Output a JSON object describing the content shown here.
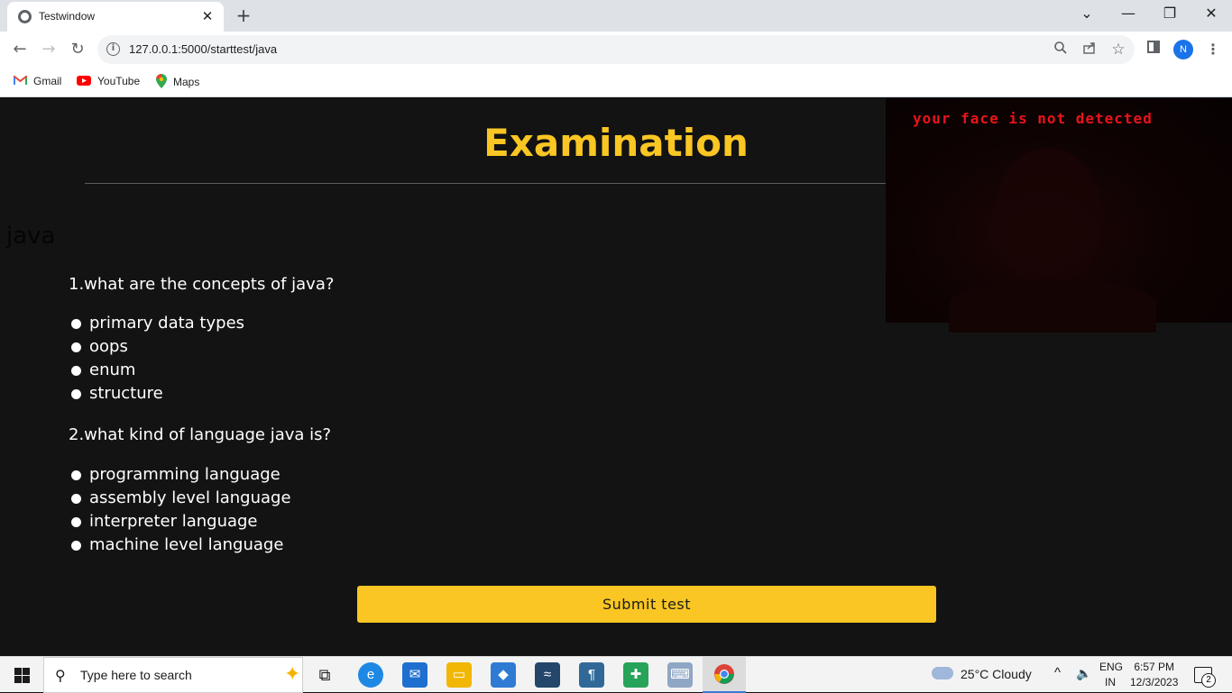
{
  "browser": {
    "tab_title": "Testwindow",
    "tab_close": "✕",
    "new_tab": "+",
    "url": "127.0.0.1:5000/starttest/java",
    "window_controls": {
      "menu": "⌄",
      "minimize": "—",
      "restore": "❐",
      "close": "✕"
    },
    "bookmarks": [
      {
        "label": "Gmail",
        "icon": "gmail-icon"
      },
      {
        "label": "YouTube",
        "icon": "youtube-icon"
      },
      {
        "label": "Maps",
        "icon": "maps-icon"
      }
    ],
    "profile_initial": "N"
  },
  "exam": {
    "title": "Examination",
    "subject": "java",
    "questions": [
      {
        "text": "1.what are the concepts of java?",
        "options": [
          "primary data types",
          "oops",
          "enum",
          "structure"
        ]
      },
      {
        "text": "2.what kind of language java is?",
        "options": [
          "programming language",
          "assembly level language",
          "interpreter language",
          "machine level language"
        ]
      }
    ],
    "submit_label": "Submit test"
  },
  "webcam": {
    "warning": "your face is not detected",
    "warning_color": "#e8141a"
  },
  "colors": {
    "accent": "#f9c623",
    "background": "#131313"
  },
  "taskbar": {
    "search_placeholder": "Type here to search",
    "weather": "25°C  Cloudy",
    "language_top": "ENG",
    "language_bottom": "IN",
    "time": "6:57 PM",
    "date": "12/3/2023",
    "notification_count": "2"
  }
}
